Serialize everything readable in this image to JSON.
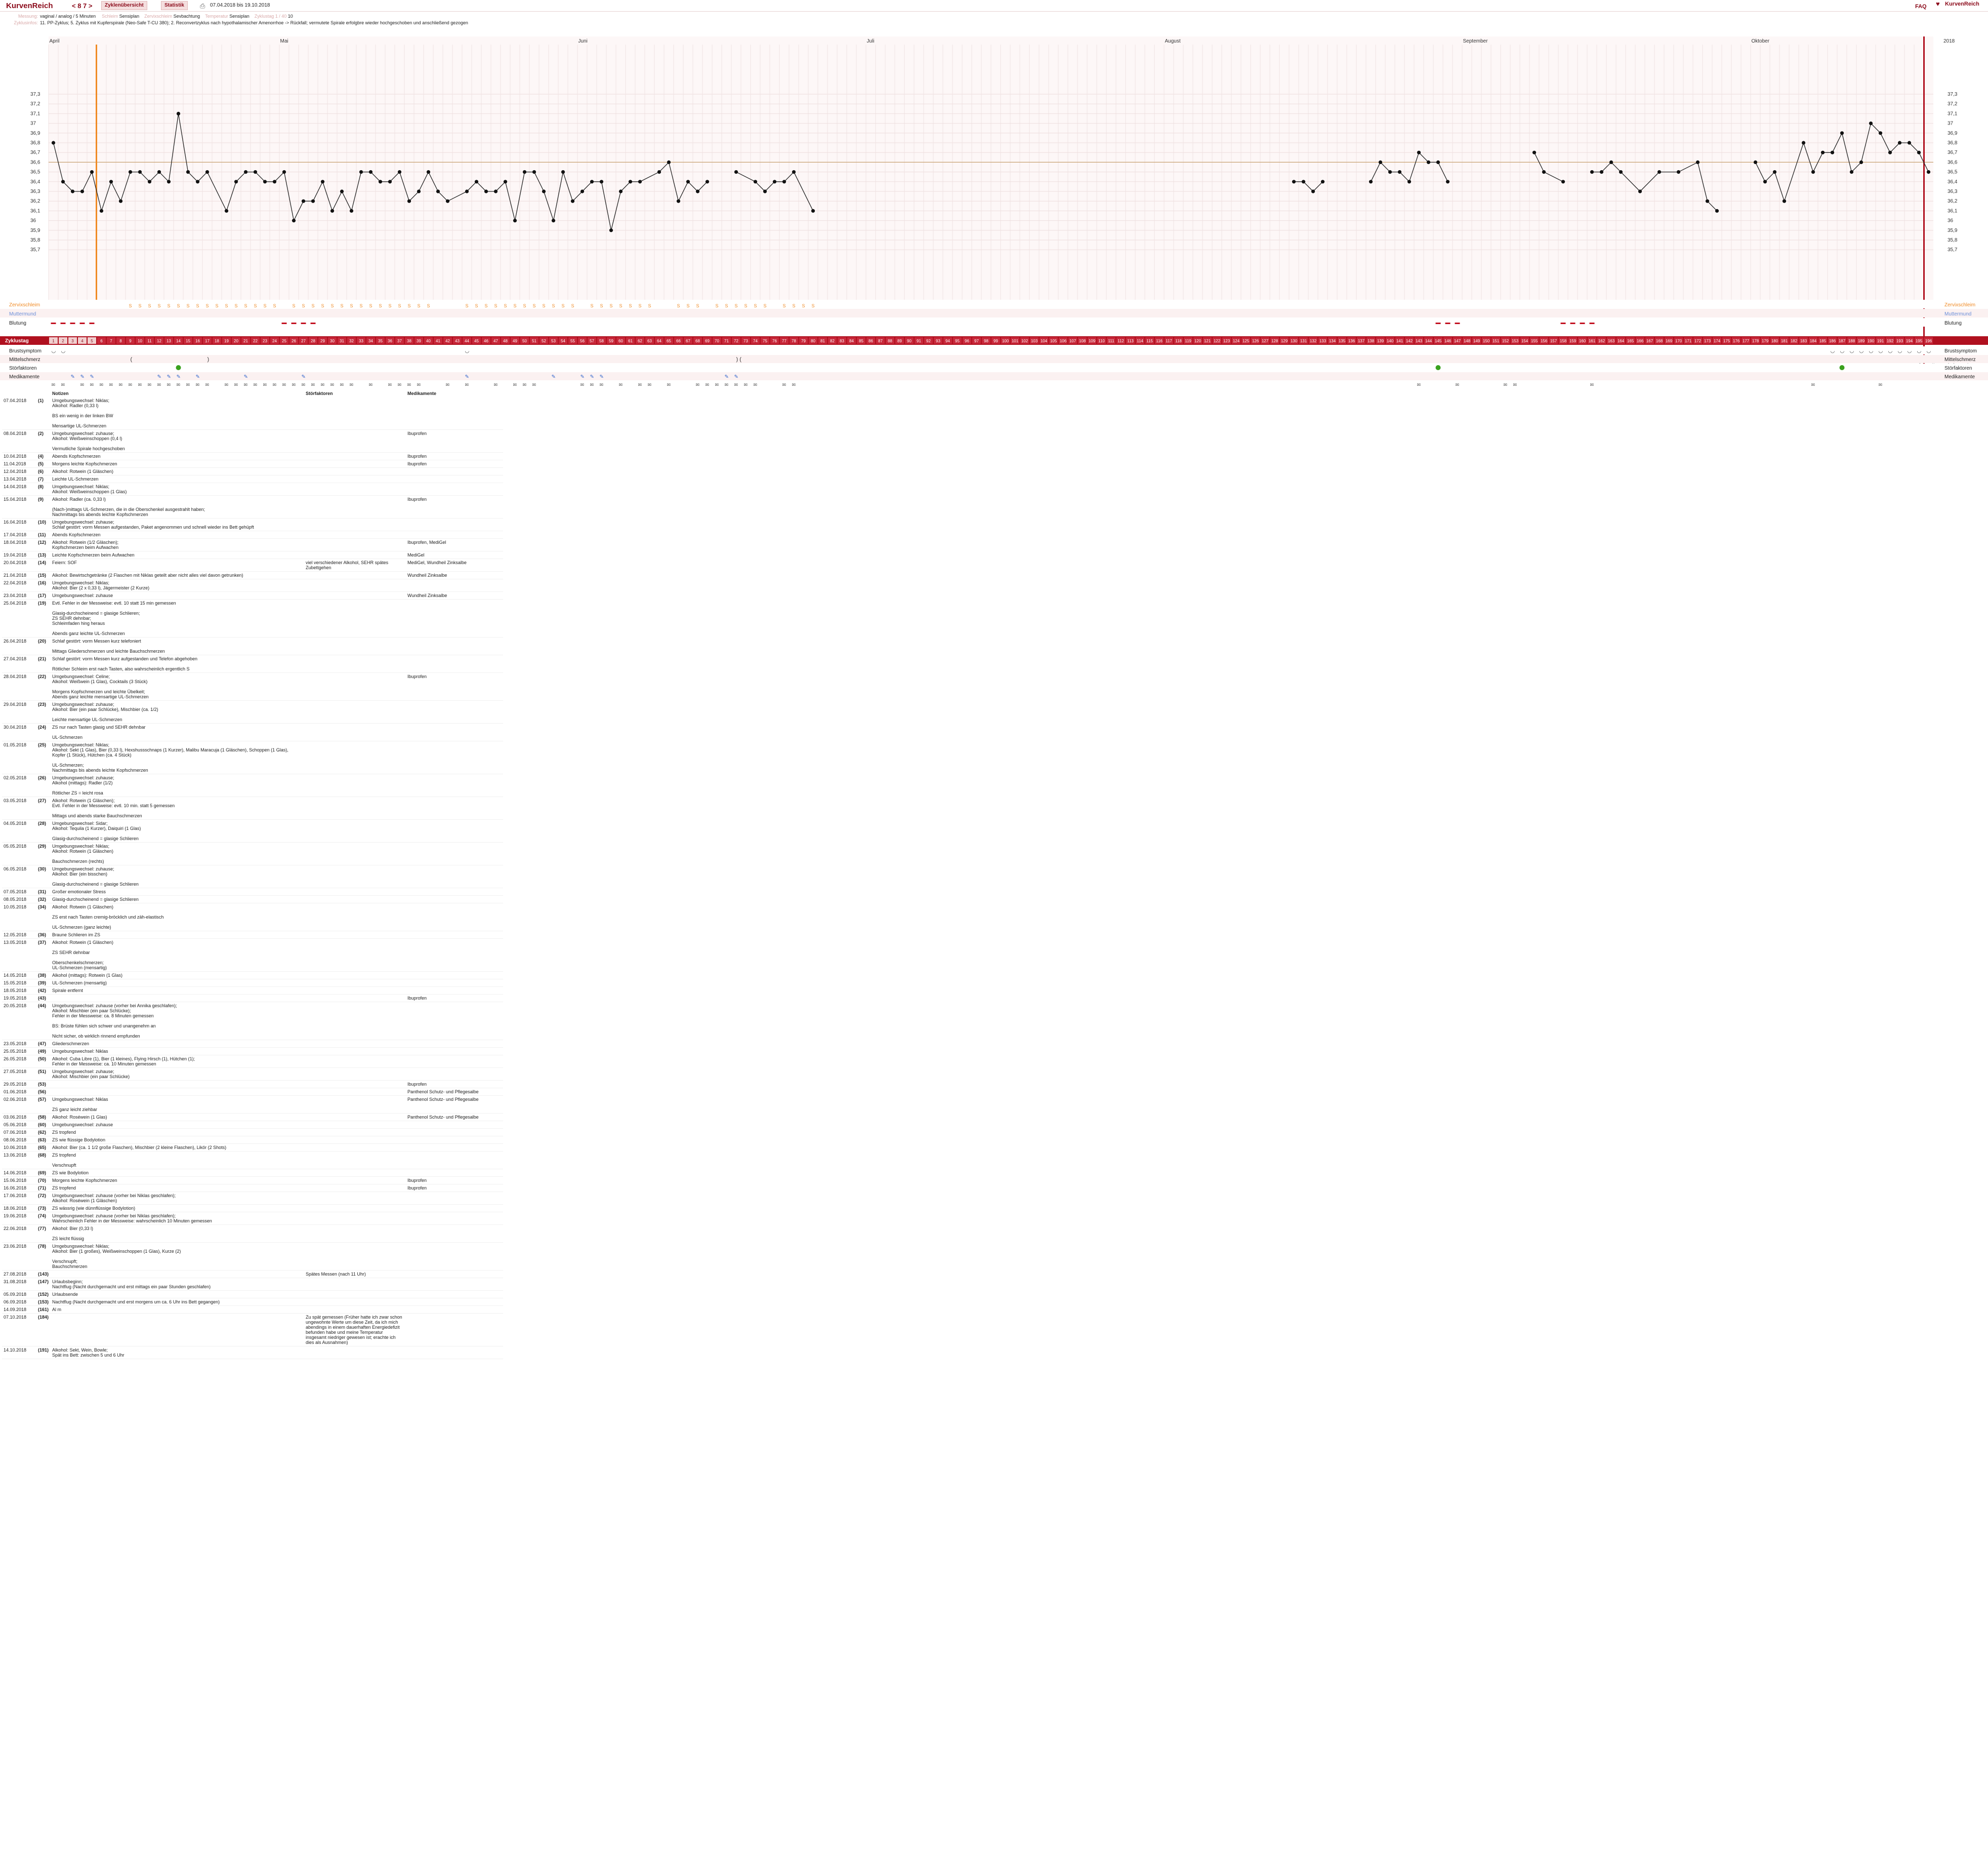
{
  "app": {
    "logo": "KurvenReich",
    "cycle_nav": "< 8 7 >",
    "btn_overview": "Zyklenübersicht",
    "btn_stats": "Statistik",
    "date_range": "07.04.2018 bis 19.10.2018",
    "faq": "FAQ",
    "brand": "KurvenReich",
    "credit": "© http://www.nfp-forum.de"
  },
  "meta": [
    {
      "k": "Messung:",
      "v": "vaginal / analog / 5 Minuten"
    },
    {
      "k": "Zyklusinfos:",
      "v": "11. PP-Zyklus; 5. Zyklus mit Kupferspirale (Neo-Safe T-CU 380); 2. Reconvertzyklus nach hypothalamischer Amenorrhoe -> Rückfall; vermutete Spirale erfolgbre wieder hochgeschoben und anschließend gezogen"
    }
  ],
  "meta_inline": [
    {
      "k": "Schleim",
      "v": "Sensiplan"
    },
    {
      "k": "Zervixschleim",
      "v": "Sevbachtung"
    },
    {
      "k": "Temperatur",
      "v": "Sensiplan"
    },
    {
      "k": "Zyklustag 1 / 40",
      "v": "10"
    }
  ],
  "months": [
    "April",
    "Mai",
    "Juni",
    "Juli",
    "August",
    "September",
    "Oktober"
  ],
  "year": "2018",
  "temp_axis": [
    "37,3",
    "37,2",
    "37,1",
    "37",
    "36,9",
    "36,8",
    "36,7",
    "36,6",
    "36,5",
    "36,4",
    "36,3",
    "36,2",
    "36,1",
    "36",
    "35,9",
    "35,8",
    "35,7"
  ],
  "row_labels": [
    "Zervixschleim",
    "Muttermund",
    "Blutung",
    "Zyklustag",
    "Brustsymptom",
    "Mittelschmerz",
    "Störfaktoren",
    "Medikamente",
    "Notizen"
  ],
  "chart_data": {
    "type": "line",
    "x": "cycle day (1–196)",
    "y_unit": "°C",
    "ylim": [
      35.7,
      37.3
    ],
    "coverline": 36.6,
    "temps": [
      [
        1,
        36.8
      ],
      [
        2,
        36.4
      ],
      [
        3,
        36.3
      ],
      [
        4,
        36.3
      ],
      [
        5,
        36.5
      ],
      [
        6,
        36.1
      ],
      [
        7,
        36.4
      ],
      [
        8,
        36.2
      ],
      [
        9,
        36.5
      ],
      [
        10,
        36.5
      ],
      [
        11,
        36.4
      ],
      [
        12,
        36.5
      ],
      [
        13,
        36.4
      ],
      [
        14,
        37.1
      ],
      [
        15,
        36.5
      ],
      [
        16,
        36.4
      ],
      [
        17,
        36.5
      ],
      [
        19,
        36.1
      ],
      [
        20,
        36.4
      ],
      [
        21,
        36.5
      ],
      [
        22,
        36.5
      ],
      [
        23,
        36.4
      ],
      [
        24,
        36.4
      ],
      [
        25,
        36.5
      ],
      [
        26,
        36.0
      ],
      [
        27,
        36.2
      ],
      [
        28,
        36.2
      ],
      [
        29,
        36.4
      ],
      [
        30,
        36.1
      ],
      [
        31,
        36.3
      ],
      [
        32,
        36.1
      ],
      [
        33,
        36.5
      ],
      [
        34,
        36.5
      ],
      [
        35,
        36.4
      ],
      [
        36,
        36.4
      ],
      [
        37,
        36.5
      ],
      [
        38,
        36.2
      ],
      [
        39,
        36.3
      ],
      [
        40,
        36.5
      ],
      [
        41,
        36.3
      ],
      [
        42,
        36.2
      ],
      [
        44,
        36.3
      ],
      [
        45,
        36.4
      ],
      [
        46,
        36.3
      ],
      [
        47,
        36.3
      ],
      [
        48,
        36.4
      ],
      [
        49,
        36.0
      ],
      [
        50,
        36.5
      ],
      [
        51,
        36.5
      ],
      [
        52,
        36.3
      ],
      [
        53,
        36.0
      ],
      [
        54,
        36.5
      ],
      [
        55,
        36.2
      ],
      [
        56,
        36.3
      ],
      [
        57,
        36.4
      ],
      [
        58,
        36.4
      ],
      [
        59,
        35.9
      ],
      [
        60,
        36.3
      ],
      [
        61,
        36.4
      ],
      [
        62,
        36.4
      ],
      [
        64,
        36.5
      ],
      [
        65,
        36.6
      ],
      [
        66,
        36.2
      ],
      [
        67,
        36.4
      ],
      [
        68,
        36.3
      ],
      [
        69,
        36.4
      ],
      [
        72,
        36.5
      ],
      [
        74,
        36.4
      ],
      [
        75,
        36.3
      ],
      [
        76,
        36.4
      ],
      [
        77,
        36.4
      ],
      [
        78,
        36.5
      ],
      [
        80,
        36.1
      ],
      [
        130,
        36.4
      ],
      [
        131,
        36.4
      ],
      [
        132,
        36.3
      ],
      [
        133,
        36.4
      ],
      [
        138,
        36.4
      ],
      [
        139,
        36.6
      ],
      [
        140,
        36.5
      ],
      [
        141,
        36.5
      ],
      [
        142,
        36.4
      ],
      [
        143,
        36.7
      ],
      [
        144,
        36.6
      ],
      [
        145,
        36.6
      ],
      [
        146,
        36.4
      ],
      [
        155,
        36.7
      ],
      [
        156,
        36.5
      ],
      [
        158,
        36.4
      ],
      [
        161,
        36.5
      ],
      [
        162,
        36.5
      ],
      [
        163,
        36.6
      ],
      [
        164,
        36.5
      ],
      [
        166,
        36.3
      ],
      [
        168,
        36.5
      ],
      [
        170,
        36.5
      ],
      [
        172,
        36.6
      ],
      [
        173,
        36.2
      ],
      [
        174,
        36.1
      ],
      [
        178,
        36.6
      ],
      [
        179,
        36.4
      ],
      [
        180,
        36.5
      ],
      [
        181,
        36.2
      ],
      [
        183,
        36.8
      ],
      [
        184,
        36.5
      ],
      [
        185,
        36.7
      ],
      [
        186,
        36.7
      ],
      [
        187,
        36.9
      ],
      [
        188,
        36.5
      ],
      [
        189,
        36.6
      ],
      [
        190,
        37.0
      ],
      [
        191,
        36.9
      ],
      [
        192,
        36.7
      ],
      [
        193,
        36.8
      ],
      [
        194,
        36.8
      ],
      [
        195,
        36.7
      ],
      [
        196,
        36.5
      ]
    ]
  },
  "cycle_day_count": 196,
  "notes_header": {
    "date": "",
    "notes": "Notizen",
    "disturb": "Störfaktoren",
    "meds": "Medikamente"
  },
  "notes": [
    {
      "d": "07.04.2018",
      "n": "(1)",
      "t": "Umgebungswechsel: Niklas;\nAlkohol: Radler (0,33 l)\n\nBS ein wenig in der linken BW\n\nMensartige UL-Schmerzen",
      "s": "",
      "m": ""
    },
    {
      "d": "08.04.2018",
      "n": "(2)",
      "t": "Umgebungswechsel: zuhause;\nAlkohol: Weißweinschoppen (0,4 l)\n\nVermutliche Spirale hochgeschoben",
      "s": "",
      "m": "Ibuprofen"
    },
    {
      "d": "10.04.2018",
      "n": "(4)",
      "t": "Abends Kopfschmerzen",
      "s": "",
      "m": "Ibuprofen"
    },
    {
      "d": "11.04.2018",
      "n": "(5)",
      "t": "Morgens leichte Kopfschmerzen",
      "s": "",
      "m": "Ibuprofen"
    },
    {
      "d": "12.04.2018",
      "n": "(6)",
      "t": "Alkohol: Rotwein (1 Gläschen)",
      "s": "",
      "m": ""
    },
    {
      "d": "13.04.2018",
      "n": "(7)",
      "t": "Leichte UL-Schmerzen",
      "s": "",
      "m": ""
    },
    {
      "d": "14.04.2018",
      "n": "(8)",
      "t": "Umgebungswechsel: Niklas;\nAlkohol: Weißweinschoppen (1 Glas)",
      "s": "",
      "m": ""
    },
    {
      "d": "15.04.2018",
      "n": "(9)",
      "t": "Alkohol: Radler (ca. 0,33 l)\n\n(Nach-)mittags UL-Schmerzen, die in die Oberschenkel ausgestrahlt haben;\nNachmittags bis abends leichte Kopfschmerzen",
      "s": "",
      "m": "Ibuprofen"
    },
    {
      "d": "16.04.2018",
      "n": "(10)",
      "t": "Umgebungswechsel: zuhause;\nSchlaf gestört: vorm Messen aufgestanden, Paket angenommen und schnell wieder ins Bett gehüpft",
      "s": "",
      "m": ""
    },
    {
      "d": "17.04.2018",
      "n": "(11)",
      "t": "Abends Kopfschmerzen",
      "s": "",
      "m": ""
    },
    {
      "d": "18.04.2018",
      "n": "(12)",
      "t": "Alkohol: Rotwein (1/2 Gläschen);\nKopfschmerzen beim Aufwachen",
      "s": "",
      "m": "Ibuprofen, MediGel"
    },
    {
      "d": "19.04.2018",
      "n": "(13)",
      "t": "Leichte Kopfschmerzen beim Aufwachen",
      "s": "",
      "m": "MediGel"
    },
    {
      "d": "20.04.2018",
      "n": "(14)",
      "t": "Feiern: SOF",
      "s": "viel verschiedener Alkohol, SEHR spätes Zubettgehen",
      "m": "MediGel, Wundheil Zinksalbe"
    },
    {
      "d": "21.04.2018",
      "n": "(15)",
      "t": "Alkohol: Bewirtschgetränke (2 Flaschen mit Niklas geteilt aber nicht alles viel davon getrunken)",
      "s": "",
      "m": "Wundheil Zinksalbe"
    },
    {
      "d": "22.04.2018",
      "n": "(16)",
      "t": "Umgebungswechsel: Niklas;\nAlkohol: Bier (2 x 0,33 l), Jägermeister (2 Kurze)",
      "s": "",
      "m": ""
    },
    {
      "d": "23.04.2018",
      "n": "(17)",
      "t": "Umgebungswechsel: zuhause",
      "s": "",
      "m": "Wundheil Zinksalbe"
    },
    {
      "d": "25.04.2018",
      "n": "(19)",
      "t": "Evtl. Fehler in der Messweise: evtl. 10 statt 15 min gemessen\n\nGlasig-durchscheinend = glasige Schlieren;\nZS SEHR dehnbar;\nSchleimfaden hing heraus\n\nAbends ganz leichte UL-Schmerzen",
      "s": "",
      "m": ""
    },
    {
      "d": "26.04.2018",
      "n": "(20)",
      "t": "Schlaf gestört: vorm Messen kurz telefoniert\n\nMittags Gliederschmerzen und leichte Bauchschmerzen",
      "s": "",
      "m": ""
    },
    {
      "d": "27.04.2018",
      "n": "(21)",
      "t": "Schlaf gestört: vorm Messen kurz aufgestanden und Telefon abgehoben\n\nRötlicher Schleim erst nach Tasten, also wahrscheinlich ergentlich S",
      "s": "",
      "m": ""
    },
    {
      "d": "28.04.2018",
      "n": "(22)",
      "t": "Umgebungswechsel: Celine;\nAlkohol: Weißwein (1 Glas), Cocktails (3 Stück)\n\nMorgens Kopfschmerzen und leichte Übelkeit;\nAbends ganz leichte mensartige UL-Schmerzen",
      "s": "",
      "m": "Ibuprofen"
    },
    {
      "d": "29.04.2018",
      "n": "(23)",
      "t": "Umgebungswechsel: zuhause;\nAlkohol: Bier (ein paar Schlücke), Mischbier (ca. 1/2)\n\nLeichte mensartige UL-Schmerzen",
      "s": "",
      "m": ""
    },
    {
      "d": "30.04.2018",
      "n": "(24)",
      "t": "ZS nur nach Tasten glasig und SEHR dehnbar\n\nUL-Schmerzen",
      "s": "",
      "m": ""
    },
    {
      "d": "01.05.2018",
      "n": "(25)",
      "t": "Umgebungswechsel: Niklas;\nAlkohol: Sekt (1 Glas), Bier (0,33 l), Hexshussschnaps (1 Kurzer), Malibu Maracuja (1 Gläschen), Schoppen (1 Glas), Kopfer (1 Stück), Hütchen (ca. 4 Stück)\n\nUL-Schmerzen;\nNachmittags bis abends leichte Kopfschmerzen",
      "s": "",
      "m": ""
    },
    {
      "d": "02.05.2018",
      "n": "(26)",
      "t": "Umgebungswechsel: zuhause;\nAlkohol (mittags): Radler (1/2)\n\nRötlicher ZS = leicht rosa",
      "s": "",
      "m": ""
    },
    {
      "d": "03.05.2018",
      "n": "(27)",
      "t": "Alkohol: Rotwein (1 Gläschen);\nEvtl. Fehler in der Messweise: evtl. 10 min. statt 5 gemessen\n\nMittags und abends starke Bauchschmerzen",
      "s": "",
      "m": ""
    },
    {
      "d": "04.05.2018",
      "n": "(28)",
      "t": "Umgebungswechsel: Sidar;\nAlkohol: Tequila (1 Kurzer), Daiquiri (1 Glas)\n\nGlasig-durchscheinend = glasige Schlieren",
      "s": "",
      "m": ""
    },
    {
      "d": "05.05.2018",
      "n": "(29)",
      "t": "Umgebungswechsel: Niklas;\nAlkohol: Rotwein (1 Gläschen)\n\nBauchschmerzen (rechts)",
      "s": "",
      "m": ""
    },
    {
      "d": "06.05.2018",
      "n": "(30)",
      "t": "Umgebungswechsel: zuhause;\nAlkohol: Bier (ein bisschen)\n\nGlasig-durchscheinend = glasige Schlieren",
      "s": "",
      "m": ""
    },
    {
      "d": "07.05.2018",
      "n": "(31)",
      "t": "Großer emotionaler Stress",
      "s": "",
      "m": ""
    },
    {
      "d": "08.05.2018",
      "n": "(32)",
      "t": "Glasig-durchscheinend = glasige Schlieren",
      "s": "",
      "m": ""
    },
    {
      "d": "10.05.2018",
      "n": "(34)",
      "t": "Alkohol: Rotwein (1 Gläschen)\n\nZS erst nach Tasten cremig-bröcklich und zäh-elastisch\n\nUL-Schmerzen (ganz leichte)",
      "s": "",
      "m": ""
    },
    {
      "d": "12.05.2018",
      "n": "(36)",
      "t": "Braune Schlieren im ZS",
      "s": "",
      "m": ""
    },
    {
      "d": "13.05.2018",
      "n": "(37)",
      "t": "Alkohol: Rotwein (1 Gläschen)\n\nZS SEHR dehnbar\n\nOberschenkelschmerzen;\nUL-Schmerzen (mensartig)",
      "s": "",
      "m": ""
    },
    {
      "d": "14.05.2018",
      "n": "(38)",
      "t": "Alkohol (mittags): Rotwein (1 Glas)",
      "s": "",
      "m": ""
    },
    {
      "d": "15.05.2018",
      "n": "(39)",
      "t": "UL-Schmerzen (mensartig)",
      "s": "",
      "m": ""
    },
    {
      "d": "18.05.2018",
      "n": "(42)",
      "t": "Spirale entfernt",
      "s": "",
      "m": ""
    },
    {
      "d": "19.05.2018",
      "n": "(43)",
      "t": "",
      "s": "",
      "m": "Ibuprofen"
    },
    {
      "d": "20.05.2018",
      "n": "(44)",
      "t": "Umgebungswechsel: zuhause (vorher bei Annika geschlafen);\nAlkohol: Mischbier (ein paar Schlücke);\nFehler in der Messweise: ca. 8 Minuten gemessen\n\nBS: Brüste fühlen sich schwer und unangenehm an\n\nNicht sicher, ob wirklich rinnend empfunden",
      "s": "",
      "m": ""
    },
    {
      "d": "23.05.2018",
      "n": "(47)",
      "t": "Gliederschmerzen",
      "s": "",
      "m": ""
    },
    {
      "d": "25.05.2018",
      "n": "(49)",
      "t": "Umgebungswechsel: Niklas",
      "s": "",
      "m": ""
    },
    {
      "d": "26.05.2018",
      "n": "(50)",
      "t": "Alkohol: Cuba Libre (1), Bier (1 kleines), Flying Hirsch (1), Hütchen (1);\nFehler in der Messweise: ca. 10 Minuten gemessen",
      "s": "",
      "m": ""
    },
    {
      "d": "27.05.2018",
      "n": "(51)",
      "t": "Umgebungswechsel: zuhause;\nAlkohol: Mischbier (ein paar Schlücke)",
      "s": "",
      "m": ""
    },
    {
      "d": "29.05.2018",
      "n": "(53)",
      "t": "",
      "s": "",
      "m": "Ibuprofen"
    },
    {
      "d": "01.06.2018",
      "n": "(56)",
      "t": "",
      "s": "",
      "m": "Panthenol Schutz- und Pflegesalbe"
    },
    {
      "d": "02.06.2018",
      "n": "(57)",
      "t": "Umgebungswechsel: Niklas\n\nZS ganz leicht ziehbar",
      "s": "",
      "m": "Panthenol Schutz- und Pflegesalbe"
    },
    {
      "d": "03.06.2018",
      "n": "(58)",
      "t": "Alkohol: Roséwein (1 Glas)",
      "s": "",
      "m": "Panthenol Schutz- und Pflegesalbe"
    },
    {
      "d": "05.06.2018",
      "n": "(60)",
      "t": "Umgebungswechsel: zuhause",
      "s": "",
      "m": ""
    },
    {
      "d": "07.06.2018",
      "n": "(62)",
      "t": "ZS tropfend",
      "s": "",
      "m": ""
    },
    {
      "d": "08.06.2018",
      "n": "(63)",
      "t": "ZS wie flüssige Bodylotion",
      "s": "",
      "m": ""
    },
    {
      "d": "10.06.2018",
      "n": "(65)",
      "t": "Alkohol: Bier (ca. 1 1/2 große Flaschen), Mischbier (2 kleine Flaschen), Likör (2 Shots)",
      "s": "",
      "m": ""
    },
    {
      "d": "13.06.2018",
      "n": "(68)",
      "t": "ZS tropfend\n\nVerschnupft",
      "s": "",
      "m": ""
    },
    {
      "d": "14.06.2018",
      "n": "(69)",
      "t": "ZS wie Bodylotion",
      "s": "",
      "m": ""
    },
    {
      "d": "15.06.2018",
      "n": "(70)",
      "t": "Morgens leichte Kopfschmerzen",
      "s": "",
      "m": "Ibuprofen"
    },
    {
      "d": "16.06.2018",
      "n": "(71)",
      "t": "ZS tropfend",
      "s": "",
      "m": "Ibuprofen"
    },
    {
      "d": "17.06.2018",
      "n": "(72)",
      "t": "Umgebungswechsel: zuhause (vorher bei Niklas geschlafen);\nAlkohol: Roséwein (1 Gläschen)",
      "s": "",
      "m": ""
    },
    {
      "d": "18.06.2018",
      "n": "(73)",
      "t": "ZS wässrig (wie dünnflüssige Bodylotion)",
      "s": "",
      "m": ""
    },
    {
      "d": "19.06.2018",
      "n": "(74)",
      "t": "Umgebungswechsel: zuhause (vorher bei Niklas geschlafen);\nWahrscheinlich Fehler in der Messweise: wahrscheinlich 10 Minuten gemessen",
      "s": "",
      "m": ""
    },
    {
      "d": "22.06.2018",
      "n": "(77)",
      "t": "Alkohol: Bier (0,33 l)\n\nZS leicht flüssig",
      "s": "",
      "m": ""
    },
    {
      "d": "23.06.2018",
      "n": "(78)",
      "t": "Umgebungswechsel: Niklas;\nAlkohol: Bier (1 großes), Weißweinschoppen (1 Glas), Kurze (2)\n\nVerschnupft;\nBauchschmerzen",
      "s": "",
      "m": ""
    },
    {
      "d": "27.08.2018",
      "n": "(143)",
      "t": "",
      "s": "Spätes Messen (nach 11 Uhr)",
      "m": ""
    },
    {
      "d": "31.08.2018",
      "n": "(147)",
      "t": "Urlaubsbeginn;\nNachtflug (Nacht durchgemacht und erst mittags ein paar Stunden geschlafen)",
      "s": "",
      "m": ""
    },
    {
      "d": "05.09.2018",
      "n": "(152)",
      "t": "Urlaubsende",
      "s": "",
      "m": ""
    },
    {
      "d": "06.09.2018",
      "n": "(153)",
      "t": "Nachtflug (Nacht durchgemacht und erst morgens um ca. 6 Uhr ins Bett gegangen)",
      "s": "",
      "m": ""
    },
    {
      "d": "14.09.2018",
      "n": "(161)",
      "t": "Al m",
      "s": "",
      "m": ""
    },
    {
      "d": "07.10.2018",
      "n": "(184)",
      "t": "",
      "s": "Zu spät gemessen (Früher hatte ich zwar schon ungewohnte Werte um diese Zeit, da ich mich abendings in einem dauerhaften Energiedefizit befunden habe und meine Temperatur insgesamt niedriger gewesen ist; erachte ich dies als Ausnahmen)",
      "m": ""
    },
    {
      "d": "14.10.2018",
      "n": "(191)",
      "t": "Alkohol: Sekt, Wein, Bowle;\nSpät ins Bett: zwischen 5 und 6 Uhr",
      "s": "",
      "m": ""
    }
  ],
  "colors": {
    "brand": "#8b0a1a",
    "accent": "#b0101f",
    "orange": "#f08a24",
    "blue": "#3366cc",
    "green": "#3aa11e",
    "coverline": "#c8a070"
  }
}
